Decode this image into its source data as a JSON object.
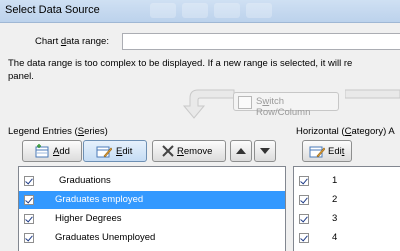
{
  "dialog": {
    "title": "Select Data Source",
    "chart_range_label_pre": "Chart ",
    "chart_range_label_key": "d",
    "chart_range_label_post": "ata range:",
    "chart_range_value": "",
    "message_line1": "The data range is too complex to be displayed. If a new range is selected, it will re",
    "message_line2": "panel.",
    "switch_pre": "S",
    "switch_key": "w",
    "switch_post": "itch Row/Column"
  },
  "legend": {
    "heading_pre": "Legend Entries (",
    "heading_key": "S",
    "heading_post": "eries)",
    "add_key": "A",
    "add_post": "dd",
    "edit_key": "E",
    "edit_post": "dit",
    "remove_key": "R",
    "remove_post": "emove",
    "items": [
      {
        "label": "Graduations",
        "checked": true,
        "selected": false
      },
      {
        "label": "Graduates employed",
        "checked": true,
        "selected": true
      },
      {
        "label": "Higher Degrees",
        "checked": true,
        "selected": false
      },
      {
        "label": "Graduates Unemployed",
        "checked": true,
        "selected": false
      }
    ]
  },
  "category": {
    "heading_pre": "Horizontal (",
    "heading_key": "C",
    "heading_post": "ategory) A",
    "edit_pre": "Edi",
    "edit_key": "t",
    "items": [
      {
        "label": "1",
        "checked": true
      },
      {
        "label": "2",
        "checked": true
      },
      {
        "label": "3",
        "checked": true
      },
      {
        "label": "4",
        "checked": true
      }
    ]
  },
  "colors": {
    "selection": "#3399ff",
    "title_bar": "#c6dbf1"
  }
}
